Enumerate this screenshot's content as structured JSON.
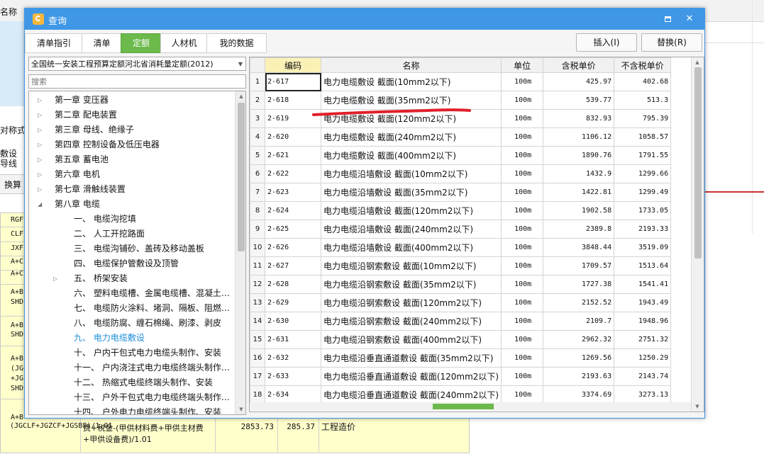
{
  "background": {
    "header_label": "名称",
    "left_texts": [
      "对称式",
      "敷设",
      "导线",
      "换算"
    ],
    "left_codes": [
      "RGF",
      "CLF",
      "JXF",
      "A+C",
      "A+C",
      "A+B",
      "SHD",
      "A+B",
      "SHD",
      "A+B",
      "(JG",
      "+JG",
      "SHD",
      "A+B"
    ],
    "bottom_row": {
      "formula": "(JGCLF+JGZCF+JGSBF)/1.01",
      "description": "费+税金-(甲供材料费+甲供主材费+甲供设备费)/1.01",
      "value1": "2853.73",
      "value2": "285.37",
      "name": "工程造价"
    }
  },
  "dialog": {
    "title": "查询",
    "min_glyph": "▭",
    "close_glyph": "✕",
    "tabs": [
      {
        "label": "清单指引",
        "active": false
      },
      {
        "label": "清单",
        "active": false
      },
      {
        "label": "定额",
        "active": true
      },
      {
        "label": "人材机",
        "active": false
      },
      {
        "label": "我的数据",
        "active": false
      }
    ],
    "insert_label": "插入(I)",
    "replace_label": "替换(R)",
    "quota_select": "全国统一安装工程预算定额河北省消耗量定额(2012)",
    "search_placeholder": "搜索",
    "tree": [
      {
        "label": "第一章  变压器",
        "level": 0,
        "expand": "collapsed"
      },
      {
        "label": "第二章  配电装置",
        "level": 0,
        "expand": "collapsed"
      },
      {
        "label": "第三章  母线、绝缘子",
        "level": 0,
        "expand": "collapsed"
      },
      {
        "label": "第四章  控制设备及低压电器",
        "level": 0,
        "expand": "collapsed"
      },
      {
        "label": "第五章  蓄电池",
        "level": 0,
        "expand": "collapsed"
      },
      {
        "label": "第六章  电机",
        "level": 0,
        "expand": "collapsed"
      },
      {
        "label": "第七章  滑触线装置",
        "level": 0,
        "expand": "collapsed"
      },
      {
        "label": "第八章  电缆",
        "level": 0,
        "expand": "expanded"
      },
      {
        "label": "一、  电缆沟挖填",
        "level": 1,
        "expand": "none"
      },
      {
        "label": "二、  人工开挖路面",
        "level": 1,
        "expand": "none"
      },
      {
        "label": "三、  电缆沟铺砂、盖砖及移动盖板",
        "level": 1,
        "expand": "none"
      },
      {
        "label": "四、  电缆保护管敷设及顶管",
        "level": 1,
        "expand": "none"
      },
      {
        "label": "五、  桥架安装",
        "level": 1,
        "expand": "collapsed"
      },
      {
        "label": "六、  塑料电缆槽、金属电缆槽、混凝土…",
        "level": 1,
        "expand": "none"
      },
      {
        "label": "七、  电缆防火涂料、堵洞、隔板、阻燃…",
        "level": 1,
        "expand": "none"
      },
      {
        "label": "八、  电缆防腐、缠石棉绳、刷漆、剥皮",
        "level": 1,
        "expand": "none"
      },
      {
        "label": "九、  电力电缆敷设",
        "level": 1,
        "expand": "none",
        "selected": true
      },
      {
        "label": "十、  户内干包式电力电缆头制作、安装",
        "level": 1,
        "expand": "none"
      },
      {
        "label": "十一、  户内浇注式电力电缆终端头制作…",
        "level": 1,
        "expand": "none"
      },
      {
        "label": "十二、  热缩式电缆终端头制作、安装",
        "level": 1,
        "expand": "none"
      },
      {
        "label": "十三、  户外干包式电力电缆终端头制作…",
        "level": 1,
        "expand": "none"
      },
      {
        "label": "十四、  户外电力电缆终端头制作、安装",
        "level": 1,
        "expand": "none"
      }
    ],
    "grid_headers": {
      "code": "编码",
      "name": "名称",
      "unit": "单位",
      "price_tax": "含税单价",
      "price_notax": "不含税单价"
    },
    "grid_rows": [
      {
        "n": "1",
        "code": "2-617",
        "name": "电力电缆敷设 截面(10mm2以下)",
        "unit": "100m",
        "tax": "425.97",
        "notax": "402.68"
      },
      {
        "n": "2",
        "code": "2-618",
        "name": "电力电缆敷设 截面(35mm2以下)",
        "unit": "100m",
        "tax": "539.77",
        "notax": "513.3"
      },
      {
        "n": "3",
        "code": "2-619",
        "name": "电力电缆敷设 截面(120mm2以下)",
        "unit": "100m",
        "tax": "832.93",
        "notax": "795.39"
      },
      {
        "n": "4",
        "code": "2-620",
        "name": "电力电缆敷设 截面(240mm2以下)",
        "unit": "100m",
        "tax": "1106.12",
        "notax": "1058.57"
      },
      {
        "n": "5",
        "code": "2-621",
        "name": "电力电缆敷设 截面(400mm2以下)",
        "unit": "100m",
        "tax": "1890.76",
        "notax": "1791.55"
      },
      {
        "n": "6",
        "code": "2-622",
        "name": "电力电缆沿墙敷设 截面(10mm2以下)",
        "unit": "100m",
        "tax": "1432.9",
        "notax": "1299.66"
      },
      {
        "n": "7",
        "code": "2-623",
        "name": "电力电缆沿墙敷设 截面(35mm2以下)",
        "unit": "100m",
        "tax": "1422.81",
        "notax": "1299.49"
      },
      {
        "n": "8",
        "code": "2-624",
        "name": "电力电缆沿墙敷设 截面(120mm2以下)",
        "unit": "100m",
        "tax": "1902.58",
        "notax": "1733.05"
      },
      {
        "n": "9",
        "code": "2-625",
        "name": "电力电缆沿墙敷设 截面(240mm2以下)",
        "unit": "100m",
        "tax": "2389.8",
        "notax": "2193.33"
      },
      {
        "n": "10",
        "code": "2-626",
        "name": "电力电缆沿墙敷设 截面(400mm2以下)",
        "unit": "100m",
        "tax": "3848.44",
        "notax": "3519.09"
      },
      {
        "n": "11",
        "code": "2-627",
        "name": "电力电缆沿钢索敷设 截面(10mm2以下)",
        "unit": "100m",
        "tax": "1709.57",
        "notax": "1513.64"
      },
      {
        "n": "12",
        "code": "2-628",
        "name": "电力电缆沿钢索敷设 截面(35mm2以下)",
        "unit": "100m",
        "tax": "1727.38",
        "notax": "1541.41"
      },
      {
        "n": "13",
        "code": "2-629",
        "name": "电力电缆沿钢索敷设 截面(120mm2以下)",
        "unit": "100m",
        "tax": "2152.52",
        "notax": "1943.49"
      },
      {
        "n": "14",
        "code": "2-630",
        "name": "电力电缆沿钢索敷设 截面(240mm2以下)",
        "unit": "100m",
        "tax": "2109.7",
        "notax": "1948.96"
      },
      {
        "n": "15",
        "code": "2-631",
        "name": "电力电缆沿钢索敷设 截面(400mm2以下)",
        "unit": "100m",
        "tax": "2962.32",
        "notax": "2751.32"
      },
      {
        "n": "16",
        "code": "2-632",
        "name": "电力电缆沿垂直通道敷设 截面(35mm2以下)",
        "unit": "100m",
        "tax": "1269.56",
        "notax": "1250.29"
      },
      {
        "n": "17",
        "code": "2-633",
        "name": "电力电缆沿垂直通道敷设 截面(120mm2以下)",
        "unit": "100m",
        "tax": "2193.63",
        "notax": "2143.74"
      },
      {
        "n": "18",
        "code": "2-634",
        "name": "电力电缆沿垂直通道敷设 截面(240mm2以下)",
        "unit": "100m",
        "tax": "3374.69",
        "notax": "3273.13"
      }
    ],
    "accent_color": "#3f97e6",
    "active_tab_color": "#6cb94c",
    "annotation_color": "#e0202a"
  }
}
